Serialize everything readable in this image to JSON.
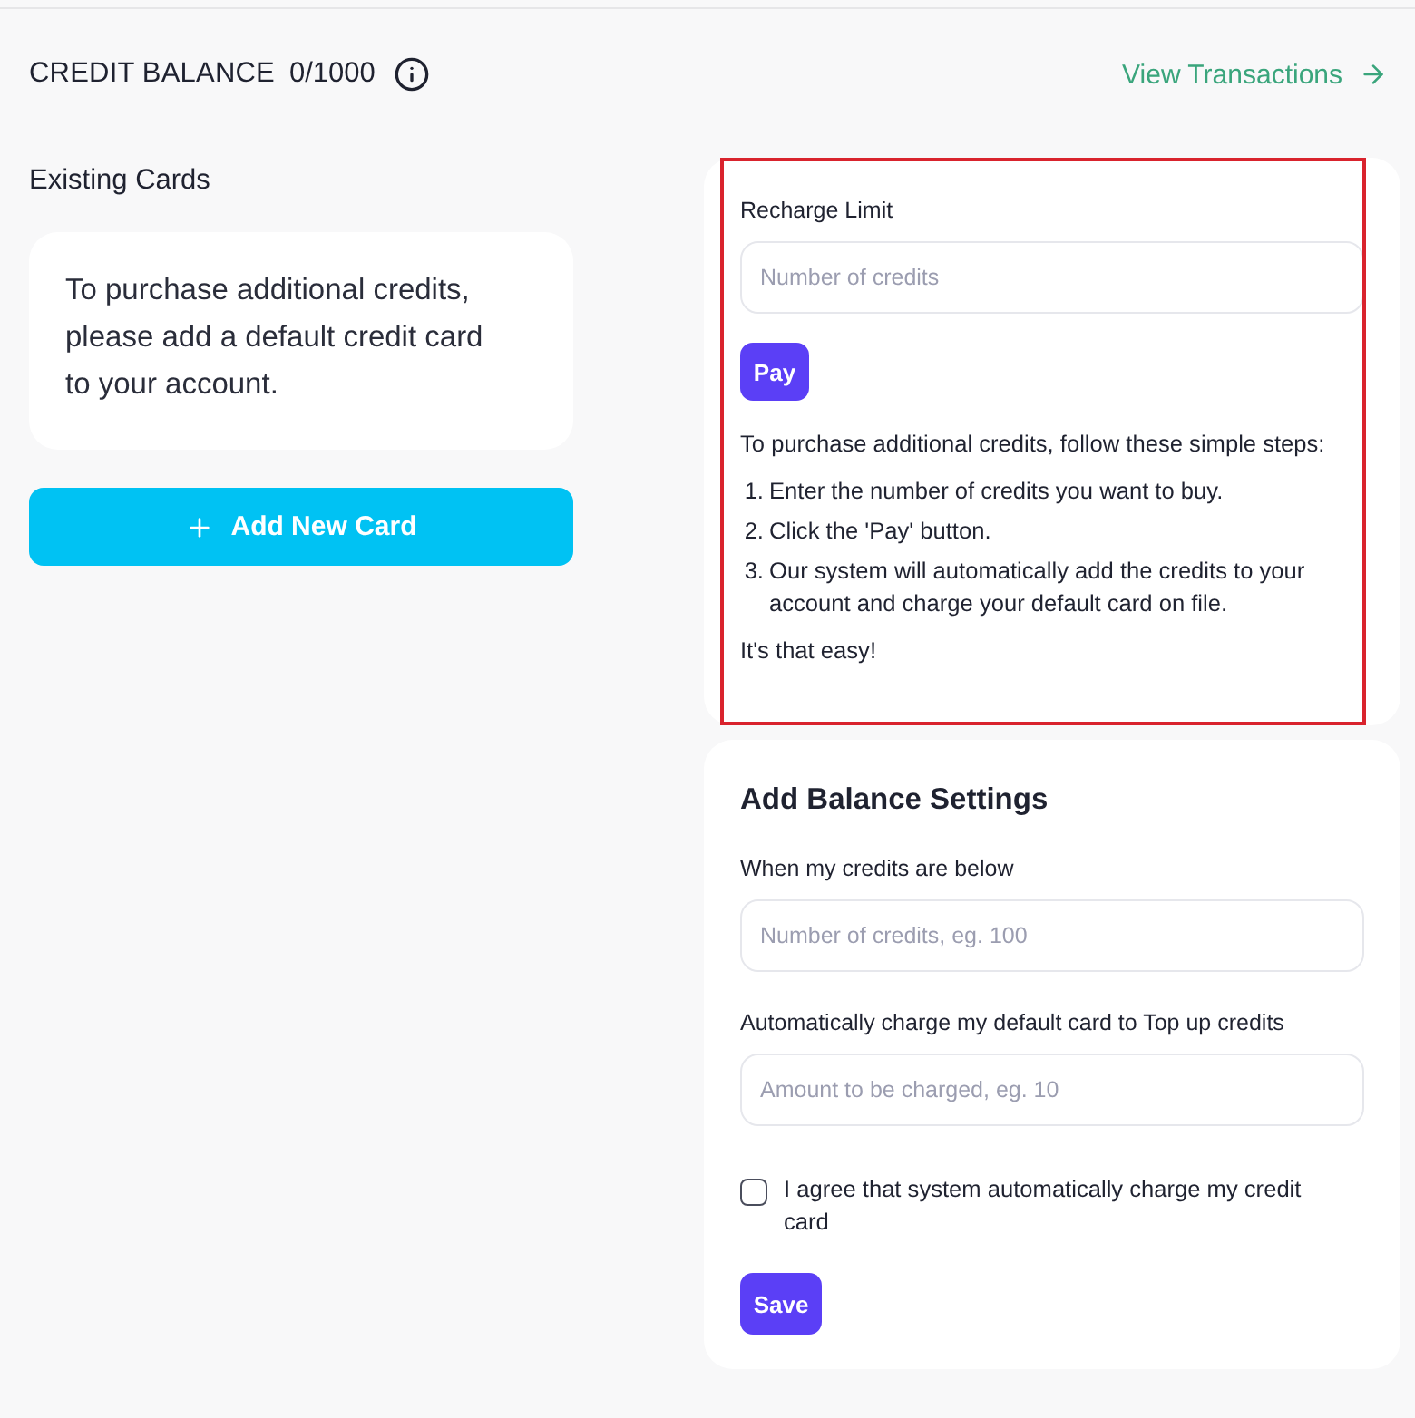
{
  "header": {
    "title": "CREDIT BALANCE",
    "balance": "0/1000",
    "link": "View Transactions"
  },
  "existing_cards": {
    "title": "Existing Cards",
    "message": "To purchase additional credits, please add a default credit card to your account.",
    "add_button": "Add New Card"
  },
  "recharge": {
    "highlighted": true,
    "label": "Recharge Limit",
    "placeholder": "Number of credits",
    "button": "Pay",
    "intro": "To purchase additional credits, follow these simple steps:",
    "steps": [
      {
        "number": "1.",
        "text": "Enter the number of credits you want to buy."
      },
      {
        "number": "2.",
        "text": "Click the 'Pay' button."
      },
      {
        "number": "3.",
        "text": "Our system will automatically add the credits to your account and charge your default card on file."
      }
    ],
    "outro": "It's that easy!"
  },
  "balance_settings": {
    "title": "Add Balance Settings",
    "fields": [
      {
        "label": "When my credits are below",
        "placeholder": "Number of credits, eg. 100"
      },
      {
        "label": "Automatically charge my default card to Top up credits",
        "placeholder": "Amount to be charged, eg. 10"
      }
    ],
    "agreement": {
      "label": "I agree that system automatically charge my credit card",
      "checked": false
    },
    "button": "Save"
  }
}
